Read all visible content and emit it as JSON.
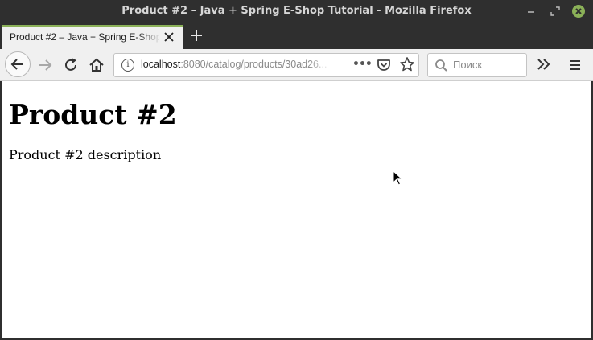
{
  "window": {
    "title": "Product #2 – Java + Spring E-Shop Tutorial - Mozilla Firefox",
    "controls": {
      "minimize": "–",
      "maximize": "⤢",
      "close": "✕"
    },
    "accent_color": "#8bb158"
  },
  "tabs": [
    {
      "label": "Product #2 – Java + Spring E-Shop Tutorial",
      "active": true
    }
  ],
  "new_tab_symbol": "+",
  "navbar": {
    "url_host": "localhost",
    "url_path": ":8080/catalog/products/30ad26...",
    "search_placeholder": "Поиск",
    "page_actions_symbol": "•••",
    "overflow_symbol": "»"
  },
  "page": {
    "heading": "Product #2",
    "description": "Product #2 description"
  }
}
